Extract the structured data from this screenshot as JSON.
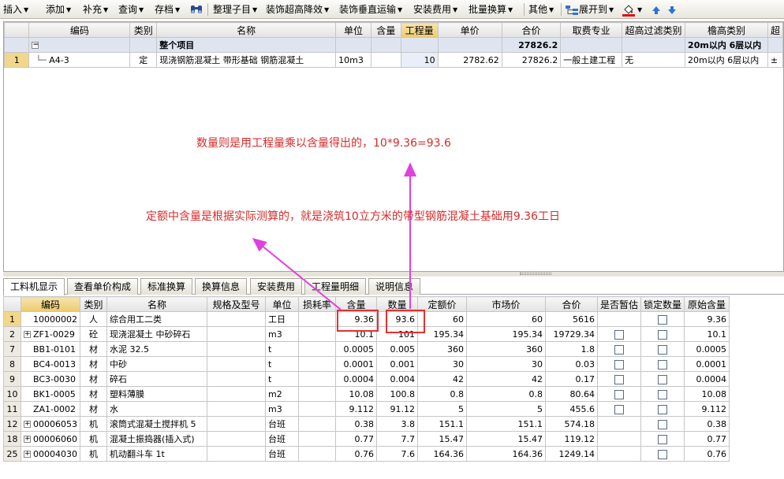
{
  "toolbar": {
    "items": [
      {
        "label": "插入"
      },
      {
        "label": "添加"
      },
      {
        "label": "补充"
      },
      {
        "label": "查询"
      },
      {
        "label": "存档"
      },
      {
        "label": "整理子目"
      },
      {
        "label": "装饰超高降效"
      },
      {
        "label": "装饰垂直运输"
      },
      {
        "label": "安装费用"
      },
      {
        "label": "批量换算"
      },
      {
        "label": "其他"
      },
      {
        "label": "展开到"
      }
    ],
    "icons": [
      "binoculars-icon",
      "expand-tree-icon",
      "paint-bucket-icon",
      "arrow-up-icon",
      "arrow-down-icon"
    ]
  },
  "top_table": {
    "headers": [
      "编码",
      "类别",
      "名称",
      "单位",
      "含量",
      "工程量",
      "单价",
      "合价",
      "取费专业",
      "超高过滤类别",
      "檐高类别",
      "超"
    ],
    "group_row": {
      "expander": "−",
      "name": "整个项目",
      "total": "27826.2",
      "eave": "20m以内 6层以内"
    },
    "rows": [
      {
        "no": "1",
        "code": "A4-3",
        "type": "定",
        "name": "现浇钢筋混凝土 带形基础 钢筋混凝土",
        "unit": "10m3",
        "content": "",
        "qty": "10",
        "price": "2782.62",
        "total": "27826.2",
        "fee": "一般土建工程",
        "filter": "无",
        "eave": "20m以内 6层以内",
        "extra": "±"
      }
    ]
  },
  "tabs": [
    "工料机显示",
    "查看单价构成",
    "标准换算",
    "换算信息",
    "安装费用",
    "工程量明细",
    "说明信息"
  ],
  "bottom_table": {
    "headers": [
      "编码",
      "类别",
      "名称",
      "规格及型号",
      "单位",
      "损耗率",
      "含量",
      "数量",
      "定额价",
      "市场价",
      "合价",
      "是否暂估",
      "锁定数量",
      "原始含量"
    ],
    "rows": [
      {
        "no": "1",
        "exp": "",
        "code": "10000002",
        "type": "人",
        "name": "综合用工二类",
        "unit": "工日",
        "content": "9.36",
        "qty": "93.6",
        "base": "60",
        "market": "60",
        "total": "5616",
        "est": false,
        "orig": "9.36"
      },
      {
        "no": "2",
        "exp": "+",
        "code": "ZF1-0029",
        "type": "砼",
        "name": "现浇混凝土 中砂碎石",
        "unit": "m3",
        "content": "10.1",
        "qty": "101",
        "base": "195.34",
        "market": "195.34",
        "total": "19729.34",
        "est": true,
        "orig": "10.1"
      },
      {
        "no": "7",
        "exp": "",
        "code": "BB1-0101",
        "type": "材",
        "name": "水泥 32.5",
        "unit": "t",
        "content": "0.0005",
        "qty": "0.005",
        "base": "360",
        "market": "360",
        "total": "1.8",
        "est": true,
        "orig": "0.0005"
      },
      {
        "no": "8",
        "exp": "",
        "code": "BC4-0013",
        "type": "材",
        "name": "中砂",
        "unit": "t",
        "content": "0.0001",
        "qty": "0.001",
        "base": "30",
        "market": "30",
        "total": "0.03",
        "est": true,
        "orig": "0.0001"
      },
      {
        "no": "9",
        "exp": "",
        "code": "BC3-0030",
        "type": "材",
        "name": "碎石",
        "unit": "t",
        "content": "0.0004",
        "qty": "0.004",
        "base": "42",
        "market": "42",
        "total": "0.17",
        "est": true,
        "orig": "0.0004"
      },
      {
        "no": "10",
        "exp": "",
        "code": "BK1-0005",
        "type": "材",
        "name": "塑料薄膜",
        "unit": "m2",
        "content": "10.08",
        "qty": "100.8",
        "base": "0.8",
        "market": "0.8",
        "total": "80.64",
        "est": true,
        "orig": "10.08"
      },
      {
        "no": "11",
        "exp": "",
        "code": "ZA1-0002",
        "type": "材",
        "name": "水",
        "unit": "m3",
        "content": "9.112",
        "qty": "91.12",
        "base": "5",
        "market": "5",
        "total": "455.6",
        "est": true,
        "orig": "9.112"
      },
      {
        "no": "12",
        "exp": "+",
        "code": "00006053",
        "type": "机",
        "name": "滚筒式混凝土搅拌机 5",
        "unit": "台班",
        "content": "0.38",
        "qty": "3.8",
        "base": "151.1",
        "market": "151.1",
        "total": "574.18",
        "est": false,
        "orig": "0.38"
      },
      {
        "no": "18",
        "exp": "+",
        "code": "00006060",
        "type": "机",
        "name": "混凝土振捣器(插入式)",
        "unit": "台班",
        "content": "0.77",
        "qty": "7.7",
        "base": "15.47",
        "market": "15.47",
        "total": "119.12",
        "est": false,
        "orig": "0.77"
      },
      {
        "no": "25",
        "exp": "+",
        "code": "00004030",
        "type": "机",
        "name": "机动翻斗车 1t",
        "unit": "台班",
        "content": "0.76",
        "qty": "7.6",
        "base": "164.36",
        "market": "164.36",
        "total": "1249.14",
        "est": false,
        "orig": "0.76"
      }
    ]
  },
  "annotations": {
    "note1": "数量则是用工程量乘以含量得出的，10*9.36=93.6",
    "note2": "定额中含量是根据实际测算的，就是浇筑10立方米的带型钢筋混凝土基础用9.36工日",
    "arrow_color": "#e040e0",
    "note_color": "#d62b2b",
    "box_color": "#e53030"
  }
}
